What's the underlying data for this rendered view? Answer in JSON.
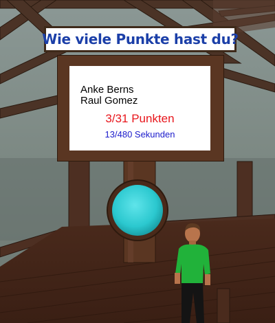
{
  "sign": {
    "title": "Wie viele Punkte hast du?"
  },
  "scoreboard": {
    "players": [
      "Anke Berns",
      "Raul Gomez"
    ],
    "points": "3/31 Punkten",
    "time": "13/480 Sekunden"
  },
  "colors": {
    "title_text": "#1b3fa8",
    "points_text": "#e8151b",
    "time_text": "#1a1acb",
    "button": "#2fd0d6",
    "wood": "#5a3622",
    "avatar_shirt": "#21b23a"
  }
}
